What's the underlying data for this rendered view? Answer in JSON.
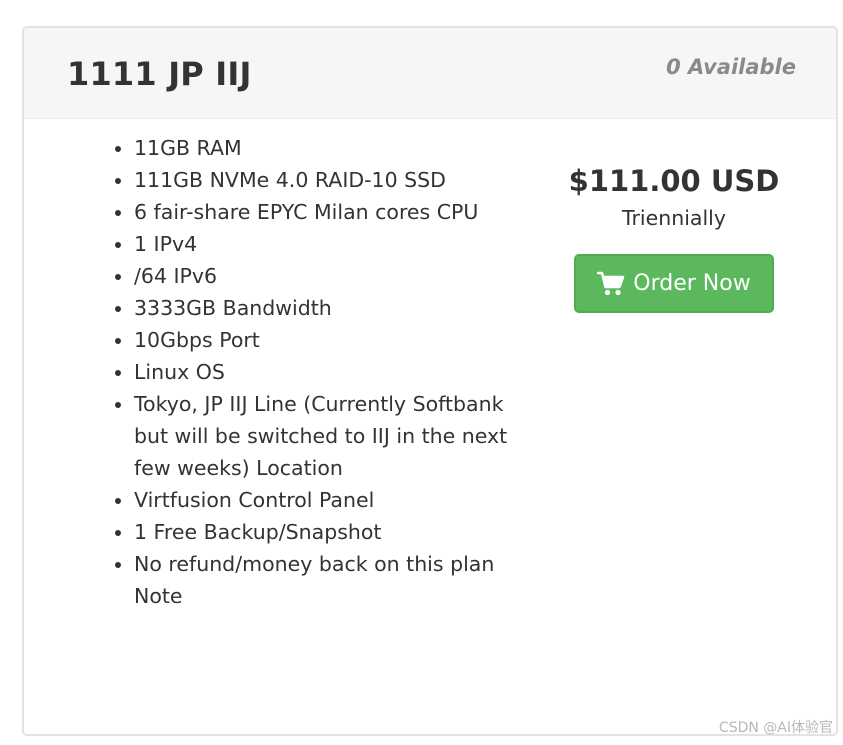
{
  "product": {
    "title": "1111 JP IIJ",
    "availability": "0 Available"
  },
  "features": [
    "11GB RAM",
    "111GB NVMe 4.0 RAID-10 SSD",
    "6 fair-share EPYC Milan cores CPU",
    "1 IPv4",
    "/64 IPv6",
    "3333GB Bandwidth",
    "10Gbps Port",
    "Linux OS",
    "Tokyo, JP IIJ Line (Currently Softbank but will be switched to IIJ in the next few weeks) Location",
    "Virtfusion Control Panel",
    "1 Free Backup/Snapshot",
    "No refund/money back on this plan Note"
  ],
  "pricing": {
    "price": "$111.00 USD",
    "cycle": "Triennially",
    "order_label": "Order Now",
    "order_icon": "shopping-cart-icon"
  },
  "watermark": "CSDN @AI体验官",
  "colors": {
    "button_bg": "#5cb85c",
    "header_bg": "#f6f6f6",
    "availability_text": "#8a8a8a"
  }
}
